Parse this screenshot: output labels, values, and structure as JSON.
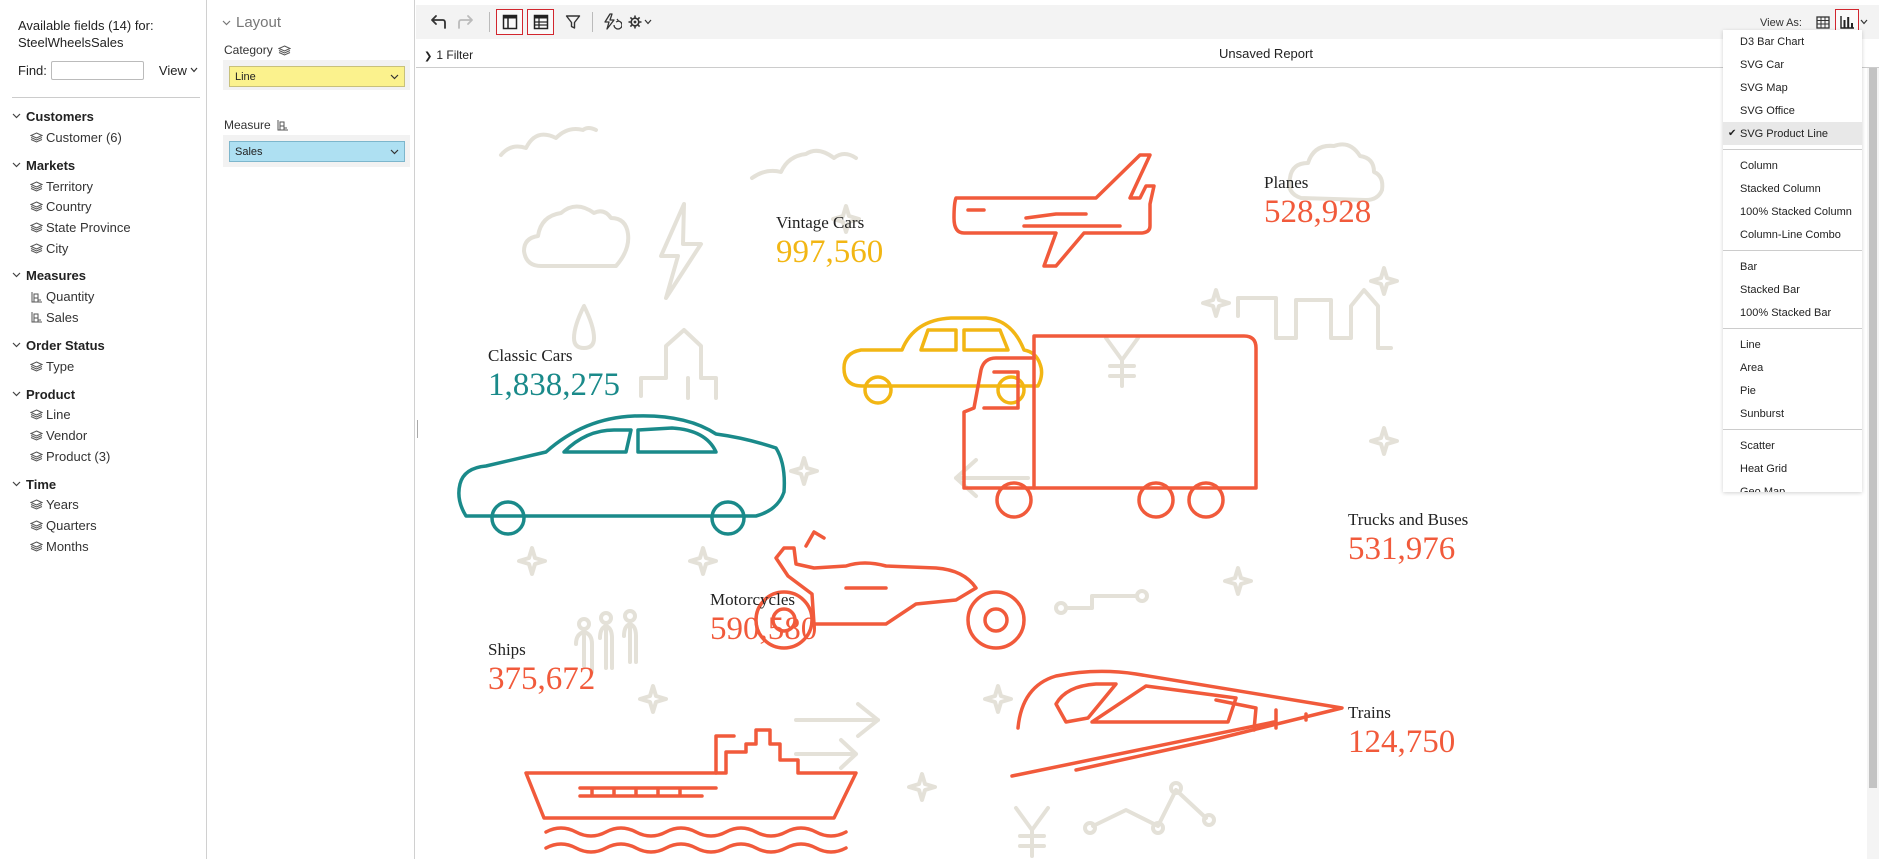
{
  "fields_panel": {
    "title": "Available fields (14) for: SteelWheelsSales",
    "find_label": "Find:",
    "find_value": "",
    "find_placeholder": "",
    "view_label": "View",
    "groups": [
      {
        "label": "Customers",
        "items": [
          {
            "label": "Customer (6)",
            "icon": "dimension-icon"
          }
        ]
      },
      {
        "label": "Markets",
        "items": [
          {
            "label": "Territory",
            "icon": "dimension-icon"
          },
          {
            "label": "Country",
            "icon": "dimension-icon"
          },
          {
            "label": "State Province",
            "icon": "dimension-icon"
          },
          {
            "label": "City",
            "icon": "dimension-icon"
          }
        ]
      },
      {
        "label": "Measures",
        "items": [
          {
            "label": "Quantity",
            "icon": "measure-icon"
          },
          {
            "label": "Sales",
            "icon": "measure-icon"
          }
        ]
      },
      {
        "label": "Order Status",
        "items": [
          {
            "label": "Type",
            "icon": "dimension-icon"
          }
        ]
      },
      {
        "label": "Product",
        "items": [
          {
            "label": "Line",
            "icon": "dimension-icon"
          },
          {
            "label": "Vendor",
            "icon": "dimension-icon"
          },
          {
            "label": "Product (3)",
            "icon": "dimension-icon"
          }
        ]
      },
      {
        "label": "Time",
        "items": [
          {
            "label": "Years",
            "icon": "dimension-icon"
          },
          {
            "label": "Quarters",
            "icon": "dimension-icon"
          },
          {
            "label": "Months",
            "icon": "dimension-icon"
          }
        ]
      }
    ]
  },
  "layout_panel": {
    "title": "Layout",
    "category_label": "Category",
    "category_value": "Line",
    "measure_label": "Measure",
    "measure_value": "Sales",
    "category_color": "#fbf28d",
    "measure_color": "#aee0f2"
  },
  "toolbar": {
    "buttons": [
      "undo-icon",
      "redo-icon",
      "toggle-field-list-icon",
      "toggle-layout-icon",
      "filter-icon",
      "auto-refresh-icon",
      "settings-icon"
    ],
    "view_as_label": "View As:",
    "view_as_buttons": [
      "table-view-icon",
      "chart-view-icon"
    ]
  },
  "report": {
    "filter_label": "1 Filter",
    "title": "Unsaved Report",
    "accent_color": "#f15a3b",
    "products": [
      {
        "name": "Planes",
        "value": "528,928",
        "color": "#f15a3b"
      },
      {
        "name": "Vintage Cars",
        "value": "997,560",
        "color": "#f2b614"
      },
      {
        "name": "Classic Cars",
        "value": "1,838,275",
        "color": "#1a8a8a"
      },
      {
        "name": "Trucks and Buses",
        "value": "531,976",
        "color": "#f15a3b"
      },
      {
        "name": "Motorcycles",
        "value": "590,580",
        "color": "#f15a3b"
      },
      {
        "name": "Ships",
        "value": "375,672",
        "color": "#f15a3b"
      },
      {
        "name": "Trains",
        "value": "124,750",
        "color": "#f15a3b"
      }
    ]
  },
  "viz_menu": {
    "selected": "SVG Product Line",
    "sections": [
      [
        "D3 Bar Chart",
        "SVG Car",
        "SVG Map",
        "SVG Office",
        "SVG Product Line"
      ],
      [
        "Column",
        "Stacked Column",
        "100% Stacked Column",
        "Column-Line Combo"
      ],
      [
        "Bar",
        "Stacked Bar",
        "100% Stacked Bar"
      ],
      [
        "Line",
        "Area",
        "Pie",
        "Sunburst"
      ],
      [
        "Scatter",
        "Heat Grid",
        "Geo Map"
      ]
    ]
  }
}
